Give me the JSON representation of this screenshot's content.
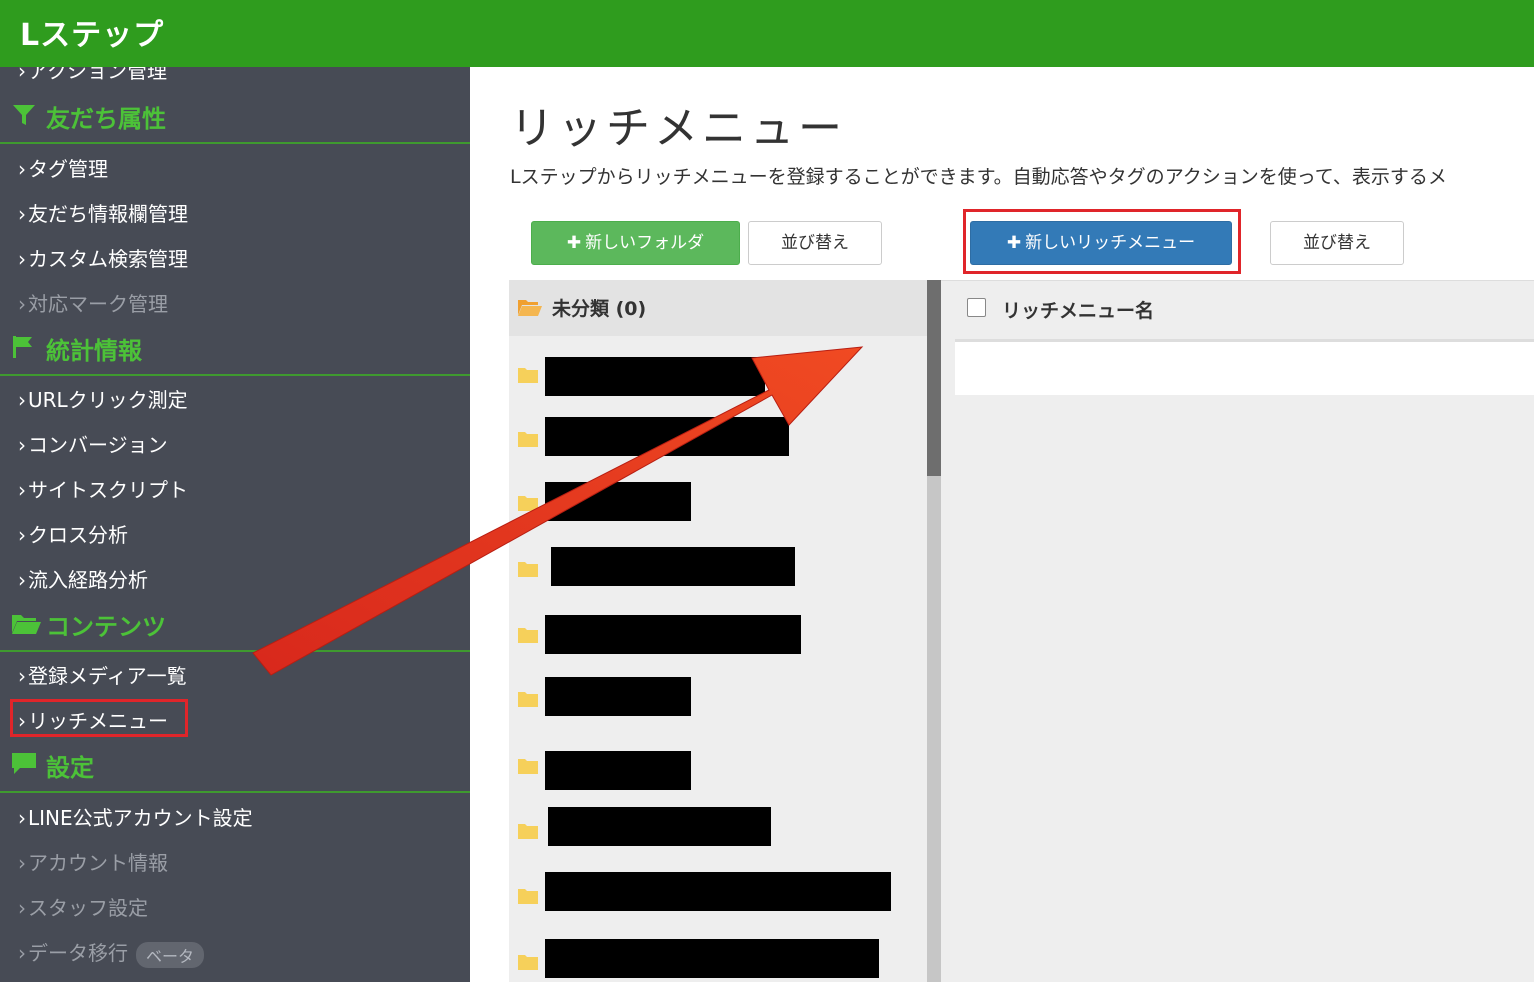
{
  "app": {
    "logo": "Lステップ"
  },
  "sidebar": {
    "cut_item": "アクション管理",
    "sections": [
      {
        "title": "友だち属性",
        "icon": "filter-icon"
      },
      {
        "title": "統計情報",
        "icon": "flag-icon"
      },
      {
        "title": "コンテンツ",
        "icon": "folder-open-icon"
      },
      {
        "title": "設定",
        "icon": "chat-bubble-icon"
      }
    ],
    "items_friends": [
      "タグ管理",
      "友だち情報欄管理",
      "カスタム検索管理",
      "対応マーク管理"
    ],
    "items_stats": [
      "URLクリック測定",
      "コンバージョン",
      "サイトスクリプト",
      "クロス分析",
      "流入経路分析"
    ],
    "items_contents": [
      "登録メディア一覧",
      "リッチメニュー"
    ],
    "items_settings": [
      "LINE公式アカウント設定",
      "アカウント情報",
      "スタッフ設定",
      "データ移行"
    ],
    "beta_badge": "ベータ"
  },
  "main": {
    "title": "リッチメニュー",
    "description": "Lステップからリッチメニューを登録することができます。自動応答やタグのアクションを使って、表示するメ",
    "new_folder_button": "新しいフォルダ",
    "sort_button_left": "並び替え",
    "new_richmenu_button": "新しいリッチメニュー",
    "sort_button_right": "並び替え",
    "folder_header": "未分類 (0)",
    "list_header": "リッチメニュー名"
  },
  "colors": {
    "topbar": "#2f9c1e",
    "sidebar": "#474b55",
    "section_title": "#4cc238",
    "highlight": "#e0252a",
    "arrow": "#e8401f",
    "primary": "#337ab7",
    "success": "#5cb85c"
  }
}
